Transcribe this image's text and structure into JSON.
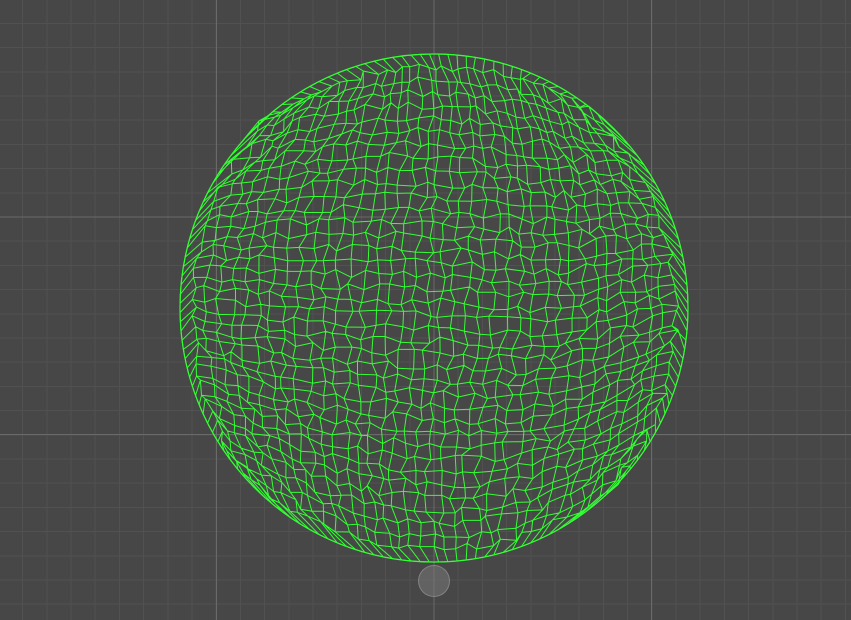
{
  "scene": {
    "background_color": "#474747",
    "grid": {
      "visible": true,
      "minor_color": "#515151",
      "major_color": "#6a6a6a"
    },
    "mesh": {
      "shape": "circle",
      "type": "quad-dominant wireframe",
      "wire_color": "#33ff33",
      "rings": 13
    },
    "pivot_handle": {
      "icon": "pivot-handle-icon",
      "visible": true
    }
  }
}
